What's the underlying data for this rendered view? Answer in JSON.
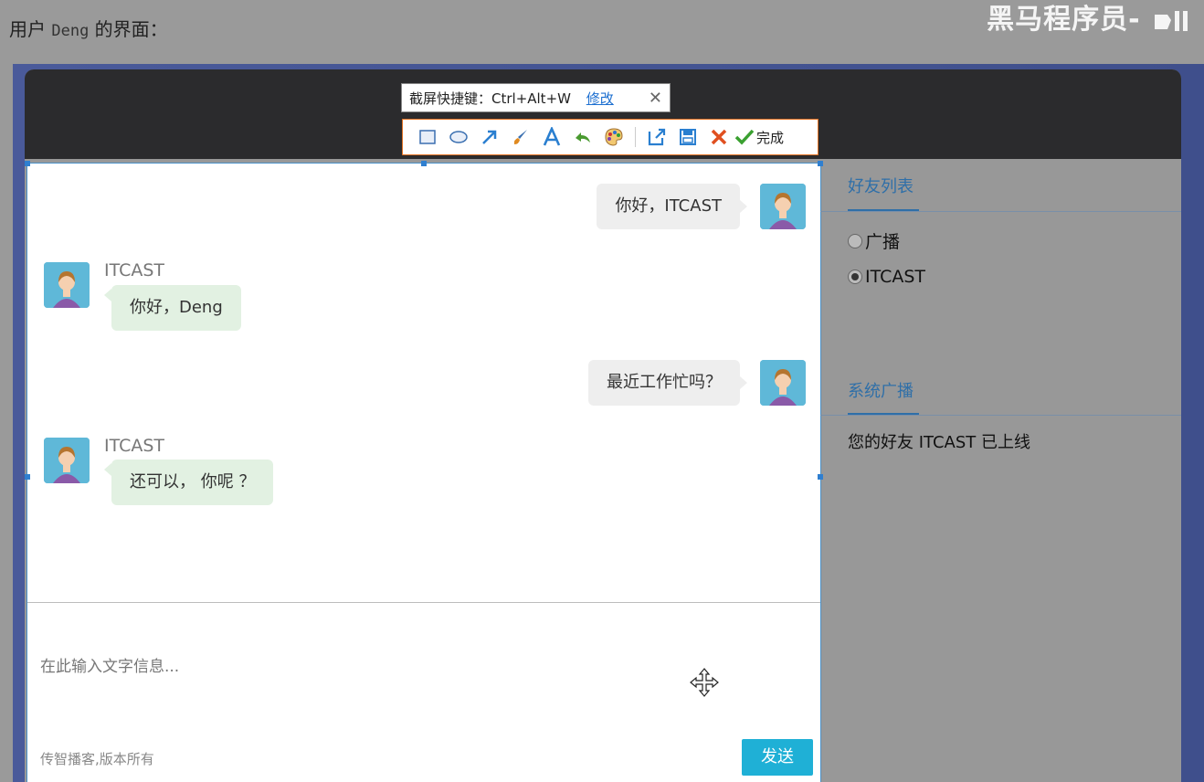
{
  "caption": {
    "prefix": "用户",
    "user": "Deng",
    "suffix": "的界面："
  },
  "watermark": {
    "text": "黑马程序员-"
  },
  "screenshot_tool": {
    "shortcut_label": "截屏快捷键：Ctrl+Alt+W",
    "modify_link": "修改",
    "close_glyph": "✕",
    "done_label": "完成",
    "tools": [
      "rectangle-icon",
      "ellipse-icon",
      "arrow-icon",
      "brush-icon",
      "text-icon",
      "undo-icon",
      "palette-icon",
      "export-icon",
      "save-icon",
      "cancel-icon",
      "done-icon"
    ]
  },
  "chat": {
    "messages": [
      {
        "from": "me",
        "text": "你好，ITCAST"
      },
      {
        "from": "other",
        "sender": "ITCAST",
        "text": "你好，Deng"
      },
      {
        "from": "me",
        "text": "最近工作忙吗？"
      },
      {
        "from": "other",
        "sender": "ITCAST",
        "text": "还可以， 你呢 ？"
      }
    ],
    "input_placeholder": "在此输入文字信息...",
    "footer": "传智播客,版本所有",
    "send_label": "发送"
  },
  "friends": {
    "title": "好友列表",
    "items": [
      {
        "label": "广播",
        "checked": false
      },
      {
        "label": "ITCAST",
        "checked": true
      }
    ]
  },
  "broadcast": {
    "title": "系统广播",
    "message": "您的好友 ITCAST 已上线"
  },
  "colors": {
    "accent": "#1fb0d6",
    "link": "#2f6fa8",
    "toolbar_border": "#e07020",
    "header": "#2b2b2d"
  }
}
